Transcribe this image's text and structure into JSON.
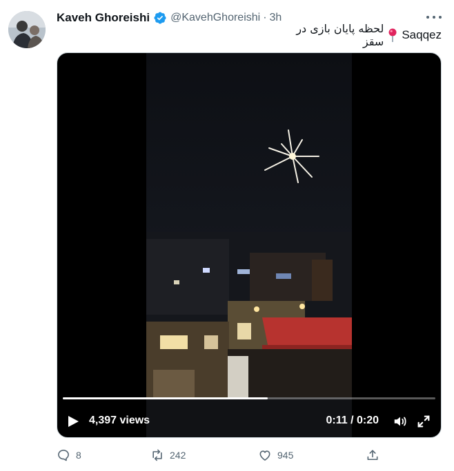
{
  "author": {
    "display_name": "Kaveh Ghoreishi",
    "handle": "@KavehGhoreishi",
    "separator": "·",
    "time": "3h",
    "verified": true
  },
  "tweet": {
    "text_latin": "Saqqez",
    "text_persian": "لحظه پایان بازی در سقز",
    "pin_icon": "round-pushpin-icon"
  },
  "video": {
    "views": "4,397 views",
    "timecode": "0:11 / 0:20",
    "progress": 0.55
  },
  "actions": {
    "replies": "8",
    "retweets": "242",
    "likes": "945"
  },
  "colors": {
    "text_primary": "#0f1419",
    "text_secondary": "#536471",
    "verified_blue": "#1d9bf0",
    "pin_red": "#e0245e"
  }
}
